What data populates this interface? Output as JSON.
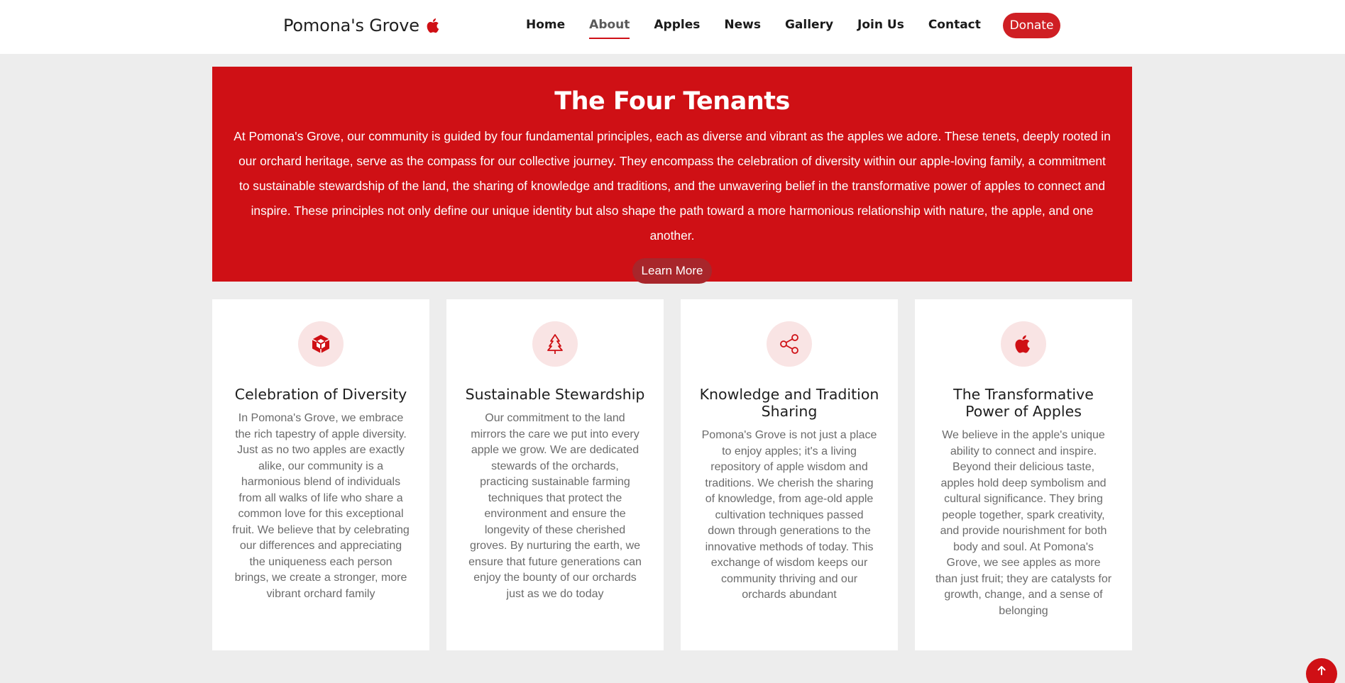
{
  "header": {
    "brand": "Pomona's Grove",
    "brand_icon": "apple-icon",
    "nav": [
      {
        "label": "Home",
        "active": false
      },
      {
        "label": "About",
        "active": true
      },
      {
        "label": "Apples",
        "active": false
      },
      {
        "label": "News",
        "active": false
      },
      {
        "label": "Gallery",
        "active": false
      },
      {
        "label": "Join Us",
        "active": false
      },
      {
        "label": "Contact",
        "active": false
      }
    ],
    "donate_label": "Donate"
  },
  "hero": {
    "title": "The Four Tenants",
    "body": "At Pomona's Grove, our community is guided by four fundamental principles, each as diverse and vibrant as the apples we adore. These tenets, deeply rooted in our orchard heritage, serve as the compass for our collective journey. They encompass the celebration of diversity within our apple-loving family, a commitment to sustainable stewardship of the land, the sharing of knowledge and traditions, and the unwavering belief in the transformative power of apples to connect and inspire. These principles not only define our unique identity but also shape the path toward a more harmonious relationship with nature, the apple, and one another.",
    "button_label": "Learn More"
  },
  "cards": [
    {
      "icon": "cube-icon",
      "title": "Celebration of Diversity",
      "body": "In Pomona's Grove, we embrace the rich tapestry of apple diversity. Just as no two apples are exactly alike, our community is a harmonious blend of individuals from all walks of life who share a common love for this exceptional fruit. We believe that by celebrating our differences and appreciating the uniqueness each person brings, we create a stronger, more vibrant orchard family"
    },
    {
      "icon": "tree-icon",
      "title": "Sustainable Stewardship",
      "body": "Our commitment to the land mirrors the care we put into every apple we grow. We are dedicated stewards of the orchards, practicing sustainable farming techniques that protect the environment and ensure the longevity of these cherished groves. By nurturing the earth, we ensure that future generations can enjoy the bounty of our orchards just as we do today"
    },
    {
      "icon": "share-icon",
      "title": "Knowledge and Tradition Sharing",
      "body": "Pomona's Grove is not just a place to enjoy apples; it's a living repository of apple wisdom and traditions. We cherish the sharing of knowledge, from age-old apple cultivation techniques passed down through generations to the innovative methods of today. This exchange of wisdom keeps our community thriving and our orchards abundant"
    },
    {
      "icon": "apple-icon",
      "title": "The Transformative Power of Apples",
      "body": "We believe in the apple's unique ability to connect and inspire. Beyond their delicious taste, apples hold deep symbolism and cultural significance. They bring people together, spark creativity, and provide nourishment for both body and soul. At Pomona's Grove, we see apples as more than just fruit; they are catalysts for growth, change, and a sense of belonging"
    }
  ],
  "colors": {
    "accent": "#cf1015",
    "page_bg": "#ededed",
    "icon_circle_bg": "#f9e4e4"
  },
  "scroll_top_icon": "arrow-up-icon"
}
